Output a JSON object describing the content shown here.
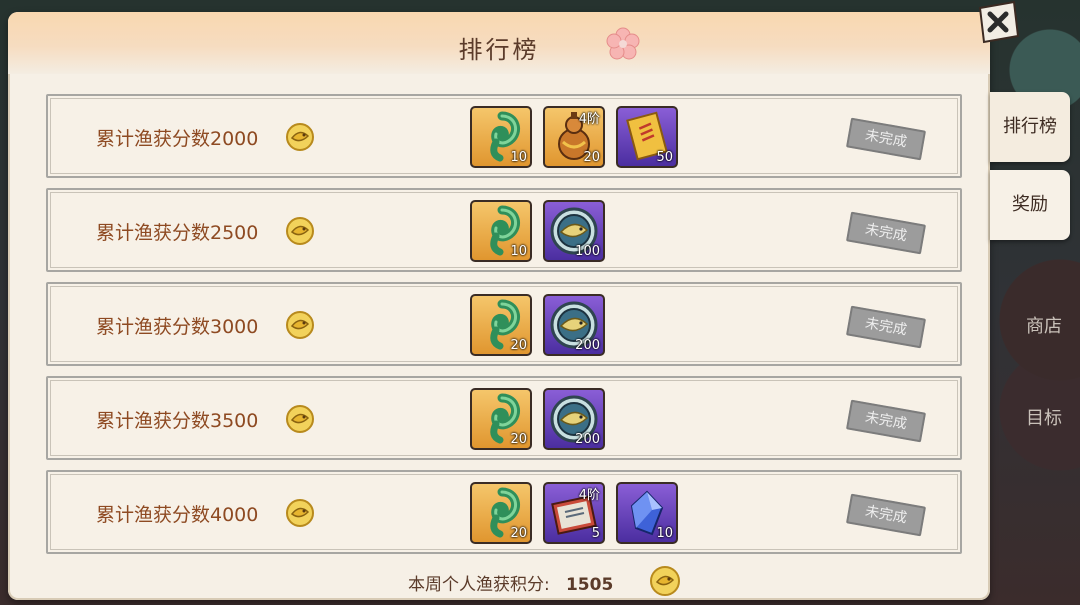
{
  "panel": {
    "title": "排行榜"
  },
  "rows": [
    {
      "label": "累计渔获分数2000",
      "status": "未完成",
      "items": [
        {
          "icon": "jade-hook-icon",
          "bg": "gold",
          "count": "10",
          "tier": ""
        },
        {
          "icon": "gourd-icon",
          "bg": "gold",
          "count": "20",
          "tier": "4阶"
        },
        {
          "icon": "scroll-icon",
          "bg": "purple",
          "count": "50",
          "tier": ""
        }
      ]
    },
    {
      "label": "累计渔获分数2500",
      "status": "未完成",
      "items": [
        {
          "icon": "jade-hook-icon",
          "bg": "gold",
          "count": "10",
          "tier": ""
        },
        {
          "icon": "fish-medal-icon",
          "bg": "purple",
          "count": "100",
          "tier": ""
        }
      ]
    },
    {
      "label": "累计渔获分数3000",
      "status": "未完成",
      "items": [
        {
          "icon": "jade-hook-icon",
          "bg": "gold",
          "count": "20",
          "tier": ""
        },
        {
          "icon": "fish-medal-icon",
          "bg": "purple",
          "count": "200",
          "tier": ""
        }
      ]
    },
    {
      "label": "累计渔获分数3500",
      "status": "未完成",
      "items": [
        {
          "icon": "jade-hook-icon",
          "bg": "gold",
          "count": "20",
          "tier": ""
        },
        {
          "icon": "fish-medal-icon",
          "bg": "purple",
          "count": "200",
          "tier": ""
        }
      ]
    },
    {
      "label": "累计渔获分数4000",
      "status": "未完成",
      "items": [
        {
          "icon": "jade-hook-icon",
          "bg": "gold",
          "count": "20",
          "tier": ""
        },
        {
          "icon": "book-icon",
          "bg": "purple",
          "count": "5",
          "tier": "4阶"
        },
        {
          "icon": "crystal-icon",
          "bg": "purple",
          "count": "10",
          "tier": ""
        }
      ]
    }
  ],
  "footer": {
    "label": "本周个人渔获积分:",
    "value": "1505"
  },
  "side_tabs": [
    {
      "label": "排行榜"
    },
    {
      "label": "奖励"
    }
  ],
  "side_background_labels": [
    "商店",
    "目标"
  ],
  "colors": {
    "label_brown": "#8e4a22",
    "stamp_grey": "#9c9c9c",
    "panel_bg": "#f6f0e6"
  }
}
